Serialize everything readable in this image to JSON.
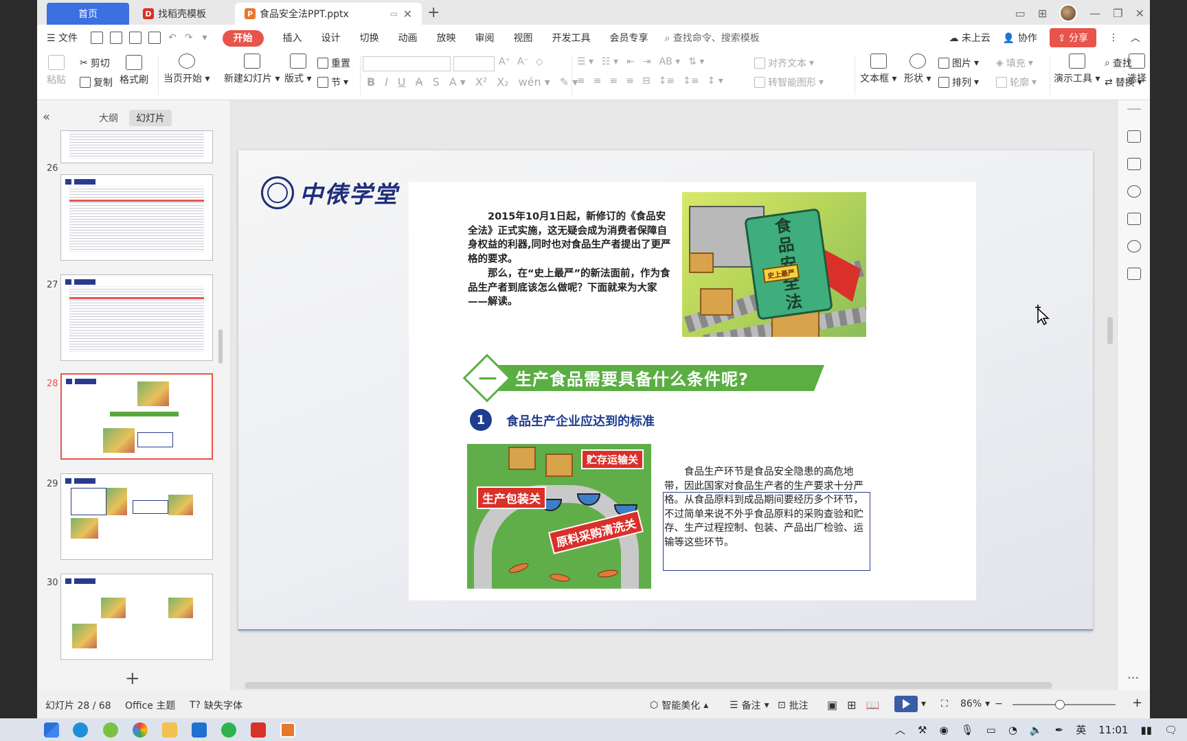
{
  "titlebar": {
    "tab_home": "首页",
    "tab_template": "找稻壳模板",
    "tab_doc": "食品安全法PPT.pptx"
  },
  "menu": {
    "file": "文件",
    "items": [
      "开始",
      "插入",
      "设计",
      "切换",
      "动画",
      "放映",
      "审阅",
      "视图",
      "开发工具",
      "会员专享"
    ],
    "search": "查找命令、搜索模板",
    "cloud": "未上云",
    "collab": "协作",
    "share": "分享"
  },
  "ribbon": {
    "paste": "粘贴",
    "cut": "剪切",
    "copy": "复制",
    "format_painter": "格式刷",
    "from_current": "当页开始",
    "new_slide": "新建幻灯片",
    "layout": "版式",
    "reset": "重置",
    "section": "节",
    "align_text": "对齐文本",
    "smart_shape": "转智能图形",
    "textbox": "文本框",
    "shape": "形状",
    "picture": "图片",
    "fill": "填充",
    "arrange": "排列",
    "outline": "轮廓",
    "present_tools": "演示工具",
    "find": "查找",
    "replace": "替换",
    "select": "选择"
  },
  "left_panel": {
    "tab_outline": "大纲",
    "tab_slides": "幻灯片",
    "thumbnails": [
      {
        "num": "26"
      },
      {
        "num": "27"
      },
      {
        "num": "28",
        "selected": true
      },
      {
        "num": "29"
      },
      {
        "num": "30"
      }
    ]
  },
  "slide": {
    "logo_text": "中俵学堂",
    "intro_p1": "2015年10月1日起，新修订的《食品安全法》正式实施，这无疑会成为消费者保障自身权益的利器,同时也对食品生产者提出了更严格的要求。",
    "intro_p2": "那么，在“史上最严”的新法面前，作为食品生产者到底该怎么做呢？下面就来为大家——解读。",
    "book_title": [
      "食",
      "品",
      "安",
      "全",
      "法"
    ],
    "book_label": "史上最严",
    "section_num": "一",
    "section_title": "生产食品需要具备什么条件呢?",
    "sub_num": "1",
    "sub_title": "食品生产企业应达到的标准",
    "illus_labels": [
      "贮存运输关",
      "生产包装关",
      "原料采购清洗关"
    ],
    "desc": "食品生产环节是食品安全隐患的高危地带，因此国家对食品生产者的生产要求十分严格。从食品原料到成品期间要经历多个环节，不过简单来说不外乎食品原料的采购查验和贮存、生产过程控制、包装、产品出厂检验、运输等这些环节。"
  },
  "status": {
    "slide_info": "幻灯片 28 / 68",
    "theme": "Office 主题",
    "missing_font": "缺失字体",
    "beautify": "智能美化",
    "notes": "备注",
    "comment": "批注",
    "zoom": "86%"
  },
  "taskbar": {
    "ime": "英",
    "time": "11:01"
  },
  "colors": {
    "accent_red": "#e8544b",
    "accent_blue": "#3c6fe0",
    "banner_green": "#5aae42",
    "navy": "#1f2d7a"
  }
}
